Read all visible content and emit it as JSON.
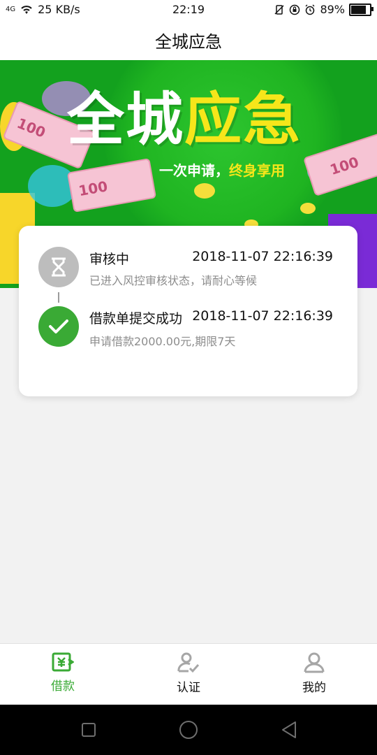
{
  "status": {
    "network": "4G",
    "speed": "25 KB/s",
    "time": "22:19",
    "battery": "89%",
    "battery_level": 0.89
  },
  "header": {
    "title": "全城应急"
  },
  "banner": {
    "title_white": "全城",
    "title_yellow": "应急",
    "subtitle_white": "一次申请，",
    "subtitle_yellow": "终身享用",
    "bill_text": "100"
  },
  "timeline": [
    {
      "status": "审核中",
      "time": "2018-11-07 22:16:39",
      "desc": "已进入风控审核状态，请耐心等候",
      "icon": "hourglass-icon",
      "color": "#bdbdbd"
    },
    {
      "status": "借款单提交成功",
      "time": "2018-11-07 22:16:39",
      "desc": "申请借款2000.00元,期限7天",
      "icon": "check-icon",
      "color": "#3aaa35"
    }
  ],
  "tabs": [
    {
      "label": "借款",
      "icon": "loan-icon",
      "active": true
    },
    {
      "label": "认证",
      "icon": "verify-user-icon",
      "active": false
    },
    {
      "label": "我的",
      "icon": "profile-icon",
      "active": false
    }
  ],
  "colors": {
    "accent": "#3aaa35",
    "banner_green": "#13a11e",
    "banner_yellow": "#f6e61a",
    "inactive": "#a6a6a6"
  }
}
